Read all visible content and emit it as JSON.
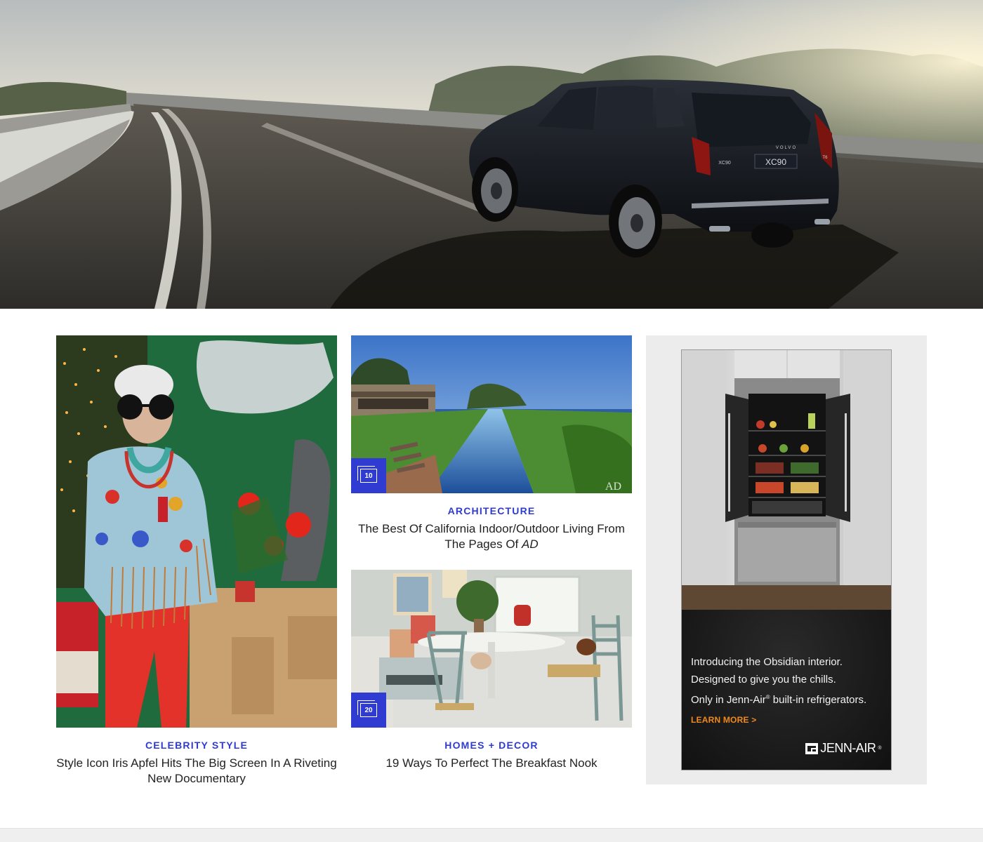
{
  "hero": {
    "alt": "hero-car-ad",
    "plate_text": "XC90",
    "badge_text": "XC90",
    "brand_text": "VOLVO",
    "trim_text": "T6"
  },
  "cards": [
    {
      "category": "Celebrity Style",
      "headline": "Style Icon Iris Apfel Hits The Big Screen In A Riveting New Documentary"
    },
    {
      "category": "Architecture",
      "headline_main": "The Best Of California Indoor/Outdoor Living From The Pages Of ",
      "headline_em": "AD",
      "gallery_count": "10",
      "watermark": "AD"
    },
    {
      "category": "Homes + Decor",
      "headline": "19 Ways To Perfect The Breakfast Nook",
      "gallery_count": "20"
    }
  ],
  "ad": {
    "copy_line1": "Introducing the Obsidian interior.",
    "copy_line2": "Designed to give you the chills.",
    "copy_line3_a": "Only in Jenn-Air",
    "copy_line3_reg": "®",
    "copy_line3_b": " built-in refrigerators.",
    "cta": "LEARN MORE >",
    "logo": "JENN-AIR",
    "logo_reg": "®",
    "cta_color": "#f08a1c"
  },
  "accent_color": "#2f3bd1"
}
